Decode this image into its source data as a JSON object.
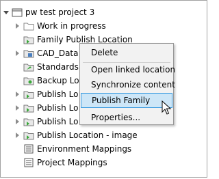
{
  "tree": {
    "root": {
      "label": "pw test project 3",
      "icon": "project-folder-icon"
    },
    "items": [
      {
        "label": "Work in progress",
        "icon": "folder-icon"
      },
      {
        "label": "Family Publish Location",
        "icon": "publish-location-icon"
      },
      {
        "label": "CAD_Data",
        "icon": "cad-folder-icon"
      },
      {
        "label": "Standards",
        "icon": "standards-folder-icon"
      },
      {
        "label": "Backup Lo",
        "icon": "backup-folder-icon"
      },
      {
        "label": "Publish Lo",
        "icon": "publish-location-icon"
      },
      {
        "label": "Publish Lo",
        "icon": "publish-location-icon"
      },
      {
        "label": "Publish Lo",
        "icon": "publish-location-icon"
      },
      {
        "label": "Publish Location - image",
        "icon": "publish-location-icon"
      },
      {
        "label": "Environment Mappings",
        "icon": "mapping-icon"
      },
      {
        "label": "Project Mappings",
        "icon": "mapping-icon"
      }
    ]
  },
  "context_menu": {
    "items": [
      {
        "label": "Delete"
      },
      {
        "label": "Open linked location"
      },
      {
        "label": "Synchronize content"
      },
      {
        "label": "Publish Family",
        "highlighted": true
      },
      {
        "label": "Properties..."
      }
    ]
  },
  "colors": {
    "highlight_bg": "#cde6f7",
    "highlight_border": "#3c9ce0",
    "folder": "#f3c24b",
    "publish_green": "#3aa83a"
  }
}
